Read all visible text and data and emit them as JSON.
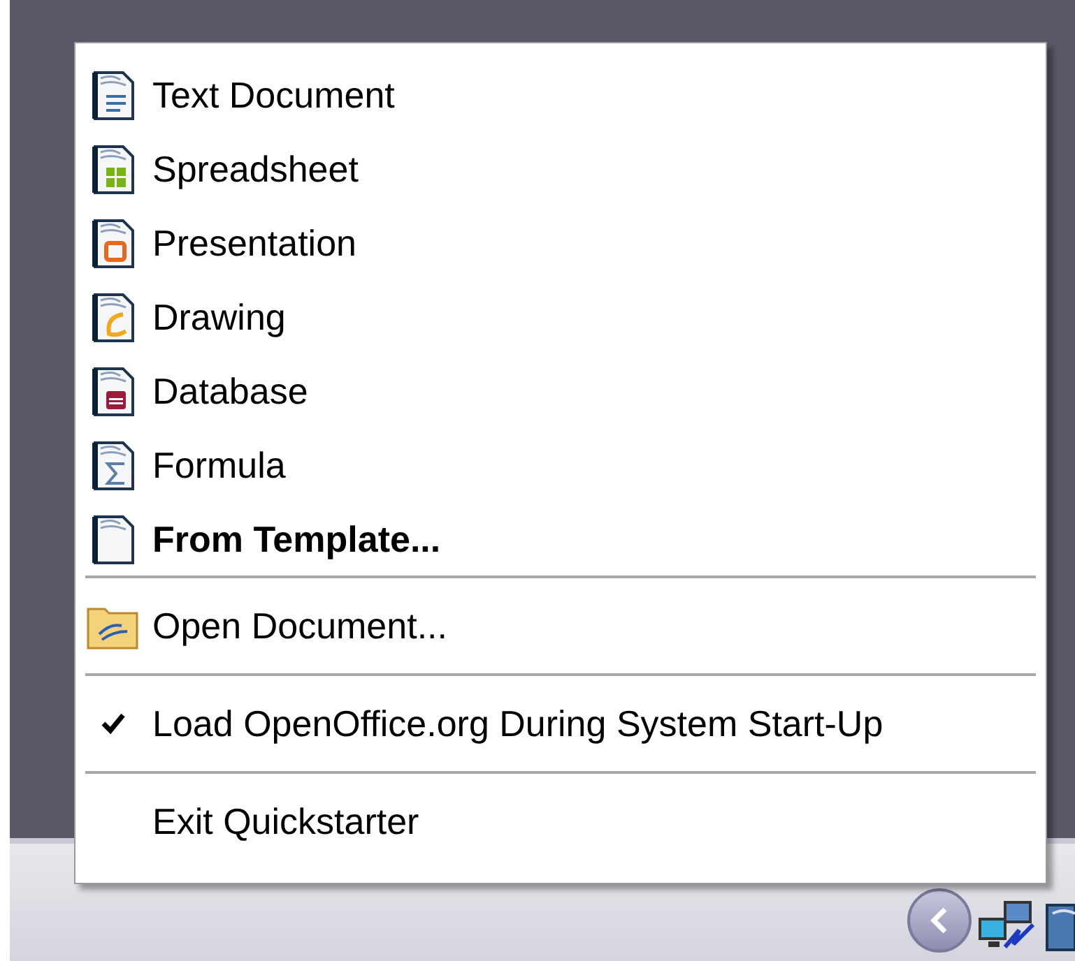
{
  "menu": {
    "groups": [
      [
        {
          "label": "Text Document",
          "checked": false,
          "default": false
        },
        {
          "label": "Spreadsheet",
          "checked": false,
          "default": false
        },
        {
          "label": "Presentation",
          "checked": false,
          "default": false
        },
        {
          "label": "Drawing",
          "checked": false,
          "default": false
        },
        {
          "label": "Database",
          "checked": false,
          "default": false
        },
        {
          "label": "Formula",
          "checked": false,
          "default": false
        },
        {
          "label": "From Template...",
          "checked": false,
          "default": true
        }
      ],
      [
        {
          "label": "Open Document...",
          "checked": false,
          "default": false
        }
      ],
      [
        {
          "label": "Load OpenOffice.org During System Start-Up",
          "checked": true,
          "default": false
        }
      ],
      [
        {
          "label": "Exit Quickstarter",
          "checked": false,
          "default": false
        }
      ]
    ]
  }
}
